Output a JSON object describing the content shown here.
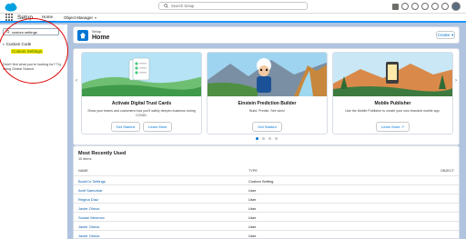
{
  "header": {
    "search_placeholder": "Search Setup"
  },
  "nav": {
    "app_name": "Setup",
    "tabs": [
      {
        "label": "Home",
        "active": true
      },
      {
        "label": "Object Manager",
        "active": false
      }
    ]
  },
  "sidebar": {
    "quick_find_value": "custom settings",
    "tree_parent": "Custom Code",
    "tree_child": "Custom Settings",
    "no_find_text": "Didn't find what you're looking for? Try using Global Search."
  },
  "page": {
    "overline": "Setup",
    "title": "Home",
    "create_label": "Create"
  },
  "carousel": {
    "cards": [
      {
        "title": "Activate Digital Trust Cards",
        "desc": "Show your teams and customers how you'll safely deepen business during COVID.",
        "buttons": [
          "Get Started",
          "Learn More"
        ]
      },
      {
        "title": "Einstein Prediction Builder",
        "desc": "Build. Predict. See wins!",
        "buttons": [
          "Get Started"
        ]
      },
      {
        "title": "Mobile Publisher",
        "desc": "Use the Mobile Publisher to create your own branded mobile app.",
        "buttons": [
          "Learn More"
        ]
      }
    ],
    "dot_count": 4,
    "active_dot": 0
  },
  "recent": {
    "title": "Most Recently Used",
    "count": "10 items",
    "columns": [
      "Name",
      "Type",
      "Object"
    ],
    "rows": [
      {
        "name": "BookCo Settings",
        "type": "Custom Setting"
      },
      {
        "name": "Amit Samurkar",
        "type": "User"
      },
      {
        "name": "Regina Díaz",
        "type": "User"
      },
      {
        "name": "Javier Olmos",
        "type": "User"
      },
      {
        "name": "Soslan Merenov",
        "type": "User"
      },
      {
        "name": "Javier Olmos",
        "type": "User"
      },
      {
        "name": "Javier Olmos",
        "type": "User"
      }
    ]
  },
  "colors": {
    "brand": "#0176d3",
    "background": "#b0c4df",
    "highlight": "#f3e700",
    "annotation": "#dd0000"
  }
}
